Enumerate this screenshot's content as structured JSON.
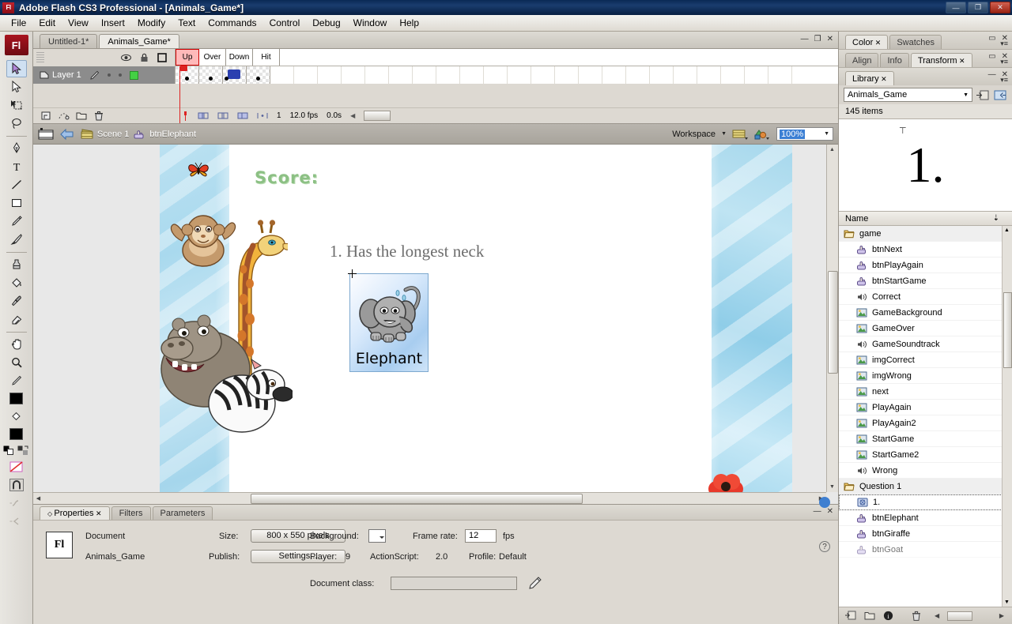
{
  "window": {
    "app_title": "Adobe Flash CS3 Professional - [Animals_Game*]",
    "badge": "Fl",
    "minimize": "—",
    "maximize": "❐",
    "close": "✕"
  },
  "menubar": {
    "items": [
      "File",
      "Edit",
      "View",
      "Insert",
      "Modify",
      "Text",
      "Commands",
      "Control",
      "Debug",
      "Window",
      "Help"
    ]
  },
  "tools": {
    "badge": "Fl",
    "items": [
      {
        "name": "selection-tool",
        "active": true
      },
      {
        "name": "subselection-tool",
        "active": false
      },
      {
        "name": "free-transform-tool",
        "active": false
      },
      {
        "name": "lasso-tool",
        "active": false
      },
      {
        "name": "pen-tool",
        "active": false
      },
      {
        "name": "text-tool",
        "active": false
      },
      {
        "name": "line-tool",
        "active": false
      },
      {
        "name": "rectangle-tool",
        "active": false
      },
      {
        "name": "pencil-tool",
        "active": false
      },
      {
        "name": "brush-tool",
        "active": false
      },
      {
        "name": "ink-bottle-tool",
        "active": false
      },
      {
        "name": "paint-bucket-tool",
        "active": false
      },
      {
        "name": "eyedropper-tool",
        "active": false
      },
      {
        "name": "eraser-tool",
        "active": false
      },
      {
        "name": "hand-tool",
        "active": false
      },
      {
        "name": "zoom-tool",
        "active": false
      }
    ]
  },
  "document_tabs": {
    "tabs": [
      {
        "label": "Untitled-1*",
        "active": false
      },
      {
        "label": "Animals_Game*",
        "active": true
      }
    ]
  },
  "timeline": {
    "layer_name": "Layer 1",
    "frame_labels": [
      "Up",
      "Over",
      "Down",
      "Hit"
    ],
    "selected_frame_label": "Up",
    "current_frame": "1",
    "fps": "12.0 fps",
    "elapsed": "0.0s"
  },
  "editbar": {
    "scene": "Scene 1",
    "symbol": "btnElephant",
    "workspace_label": "Workspace",
    "zoom": "100%"
  },
  "stage": {
    "score_label": "Score:",
    "question_text": "1. Has the longest neck",
    "button_label": "Elephant"
  },
  "properties": {
    "tabs": [
      {
        "label": "Properties",
        "active": true
      },
      {
        "label": "Filters",
        "active": false
      },
      {
        "label": "Parameters",
        "active": false
      }
    ],
    "icon_text": "Fl",
    "type_label": "Document",
    "doc_name": "Animals_Game",
    "size_label": "Size:",
    "size_value": "800 x 550 pixels",
    "publish_label": "Publish:",
    "publish_value": "Settings...",
    "background_label": "Background:",
    "framerate_label": "Frame rate:",
    "framerate_value": "12",
    "fps_unit": "fps",
    "player_label": "Player:",
    "player_value": "9",
    "actionscript_label": "ActionScript:",
    "actionscript_value": "2.0",
    "profile_label": "Profile:",
    "profile_value": "Default",
    "docclass_label": "Document class:",
    "docclass_value": "",
    "help_glyph": "?",
    "access_glyph": "♿"
  },
  "right_dock": {
    "color_panel": {
      "tabs": [
        {
          "label": "Color",
          "active": true,
          "closable": true
        },
        {
          "label": "Swatches",
          "active": false,
          "closable": false
        }
      ]
    },
    "align_panel": {
      "tabs": [
        {
          "label": "Align",
          "active": false,
          "closable": false
        },
        {
          "label": "Info",
          "active": false,
          "closable": false
        },
        {
          "label": "Transform",
          "active": true,
          "closable": true
        }
      ]
    },
    "library": {
      "tab_label": "Library",
      "select_value": "Animals_Game",
      "item_count": "145 items",
      "preview_text": "1.",
      "column_header": "Name",
      "items": [
        {
          "label": "game",
          "icon": "folder-icon",
          "type": "folder",
          "selected": false
        },
        {
          "label": "btnNext",
          "icon": "button-symbol-icon",
          "type": "button",
          "selected": false
        },
        {
          "label": "btnPlayAgain",
          "icon": "button-symbol-icon",
          "type": "button",
          "selected": false
        },
        {
          "label": "btnStartGame",
          "icon": "button-symbol-icon",
          "type": "button",
          "selected": false
        },
        {
          "label": "Correct",
          "icon": "sound-icon",
          "type": "sound",
          "selected": false
        },
        {
          "label": "GameBackground",
          "icon": "bitmap-icon",
          "type": "bitmap",
          "selected": false
        },
        {
          "label": "GameOver",
          "icon": "bitmap-icon",
          "type": "bitmap",
          "selected": false
        },
        {
          "label": "GameSoundtrack",
          "icon": "sound-icon",
          "type": "sound",
          "selected": false
        },
        {
          "label": "imgCorrect",
          "icon": "bitmap-icon",
          "type": "bitmap",
          "selected": false
        },
        {
          "label": "imgWrong",
          "icon": "bitmap-icon",
          "type": "bitmap",
          "selected": false
        },
        {
          "label": "next",
          "icon": "bitmap-icon",
          "type": "bitmap",
          "selected": false
        },
        {
          "label": "PlayAgain",
          "icon": "bitmap-icon",
          "type": "bitmap",
          "selected": false
        },
        {
          "label": "PlayAgain2",
          "icon": "bitmap-icon",
          "type": "bitmap",
          "selected": false
        },
        {
          "label": "StartGame",
          "icon": "bitmap-icon",
          "type": "bitmap",
          "selected": false
        },
        {
          "label": "StartGame2",
          "icon": "bitmap-icon",
          "type": "bitmap",
          "selected": false
        },
        {
          "label": "Wrong",
          "icon": "sound-icon",
          "type": "sound",
          "selected": false
        },
        {
          "label": "Question 1",
          "icon": "folder-icon",
          "type": "folder",
          "selected": false
        },
        {
          "label": "1.",
          "icon": "movieclip-icon",
          "type": "movieclip",
          "selected": true
        },
        {
          "label": "btnElephant",
          "icon": "button-symbol-icon",
          "type": "button",
          "selected": false
        },
        {
          "label": "btnGiraffe",
          "icon": "button-symbol-icon",
          "type": "button",
          "selected": false
        },
        {
          "label": "btnGoat",
          "icon": "button-symbol-icon",
          "type": "button",
          "selected": false
        }
      ]
    }
  }
}
